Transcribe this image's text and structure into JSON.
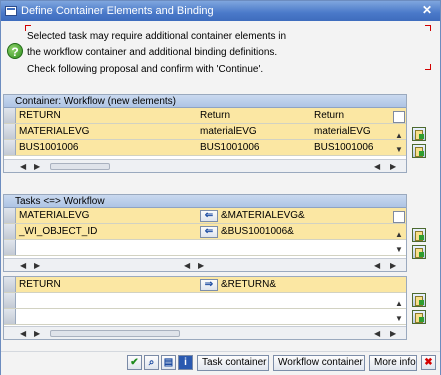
{
  "window": {
    "title": "Define Container Elements and Binding"
  },
  "message": {
    "line1": "Selected task may require additional container elements in",
    "line2": "the workflow container and additional binding definitions.",
    "line3": "Check following proposal and confirm with 'Continue'."
  },
  "container_table": {
    "header": "Container: Workflow (new elements)",
    "rows": [
      [
        "RETURN",
        "Return",
        "Return"
      ],
      [
        "MATERIALEVG",
        "materialEVG",
        "materialEVG"
      ],
      [
        "BUS1001006",
        "BUS1001006",
        "BUS1001006"
      ]
    ]
  },
  "binding_table": {
    "header": "Tasks <=> Workflow",
    "rows": [
      {
        "left": "MATERIALEVG",
        "direction": "left-arrow",
        "right": "&MATERIALEVG&"
      },
      {
        "left": "_WI_OBJECT_ID",
        "direction": "left-arrow",
        "right": "&BUS1001006&"
      }
    ]
  },
  "return_table": {
    "rows": [
      {
        "left": "RETURN",
        "direction": "right-arrow",
        "right": "&RETURN&"
      }
    ]
  },
  "toolbar": {
    "icons": [
      "check-icon",
      "find-icon",
      "trash-icon",
      "info-icon"
    ],
    "task_container": "Task container",
    "workflow_container": "Workflow container",
    "more_info": "More info",
    "cancel_icon": "cancel-icon"
  },
  "colors": {
    "title_bar": "#4a79c9",
    "row_highlight": "#fbe7a3",
    "grid_header": "#aec4e4"
  }
}
